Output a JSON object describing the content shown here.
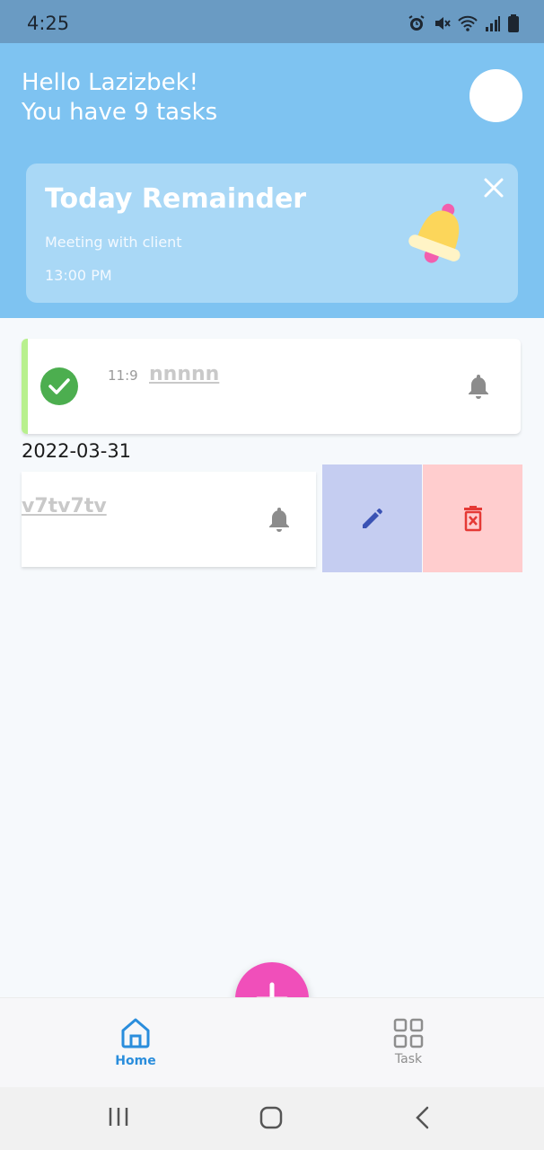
{
  "status_bar": {
    "time": "4:25",
    "icons": [
      "alarm-icon",
      "mute-icon",
      "wifi-icon",
      "signal-icon",
      "battery-icon"
    ]
  },
  "header": {
    "greeting_line1": "Hello Lazizbek!",
    "greeting_line2": "You have 9 tasks"
  },
  "reminder": {
    "title": "Today Remainder",
    "description": "Meeting with client",
    "time": "13:00 PM"
  },
  "tasks": [
    {
      "time": "11:9",
      "name": "nnnnn",
      "completed": true,
      "accent_color": "#b8f08e"
    },
    {
      "date_header": "2022-03-31",
      "name": "v7tv7tv",
      "completed": false
    }
  ],
  "swipe_actions": {
    "edit_color": "#c5cdf1",
    "delete_color": "#ffcdce"
  },
  "bottom_nav": {
    "home_label": "Home",
    "task_label": "Task"
  },
  "colors": {
    "header_bg": "#7ec3f1",
    "fab": "#f04fba",
    "active_nav": "#2a8ddc"
  }
}
